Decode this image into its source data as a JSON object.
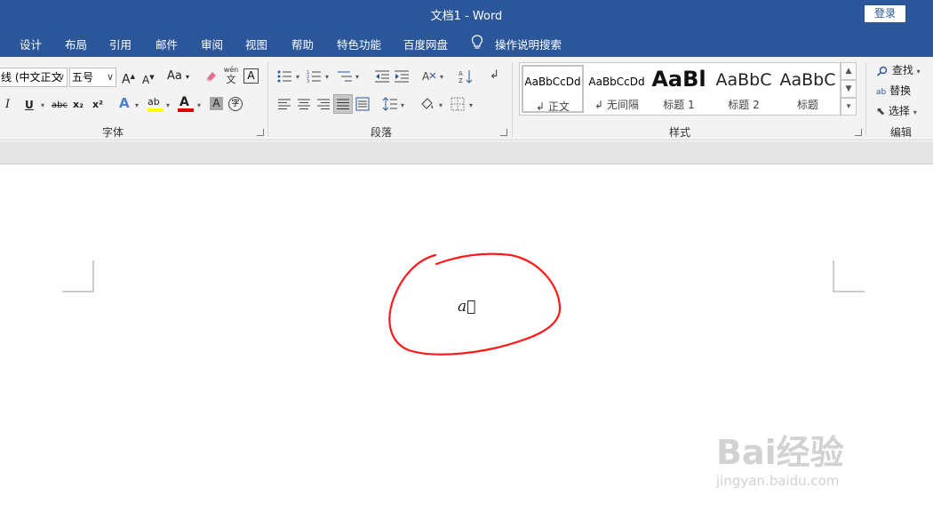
{
  "window": {
    "title": "文档1  -  Word",
    "login_button": "登录"
  },
  "menu": {
    "tabs": [
      "设计",
      "布局",
      "引用",
      "邮件",
      "审阅",
      "视图",
      "帮助",
      "特色功能",
      "百度网盘"
    ],
    "tell_me": "操作说明搜索"
  },
  "font_group": {
    "label": "字体",
    "font_name": "线 (中文正文",
    "font_size": "五号",
    "grow_font": "A",
    "shrink_font": "A",
    "change_case": "Aa",
    "pinyin_top": "wén",
    "pinyin_bottom": "文",
    "char_border": "A",
    "italic": "I",
    "underline": "U",
    "strike": "abc",
    "subscript": "x₂",
    "superscript": "x²",
    "text_effects": "A",
    "highlight": "ab",
    "font_color": "A",
    "char_shading": "A",
    "enclose": "字",
    "highlight_color": "#ffff00",
    "font_color_value": "#ff0000"
  },
  "paragraph_group": {
    "label": "段落"
  },
  "styles_group": {
    "label": "样式",
    "items": [
      {
        "sample": "AaBbCcDd",
        "name": "正文"
      },
      {
        "sample": "AaBbCcDd",
        "name": "无间隔"
      },
      {
        "sample": "AaBl",
        "name": "标题 1"
      },
      {
        "sample": "AaBbC",
        "name": "标题 2"
      },
      {
        "sample": "AaBbC",
        "name": "标题"
      }
    ]
  },
  "editing_group": {
    "label": "编辑",
    "find": "查找",
    "replace": "替换",
    "select": "选择"
  },
  "document": {
    "formula": "a⃗"
  },
  "annotation": {
    "color": "#ff0000"
  },
  "watermark": {
    "brand": "Bai经验",
    "url": "jingyan.baidu.com"
  },
  "theme": {
    "accent": "#2b579a",
    "ribbon_bg": "#f3f3f3"
  }
}
